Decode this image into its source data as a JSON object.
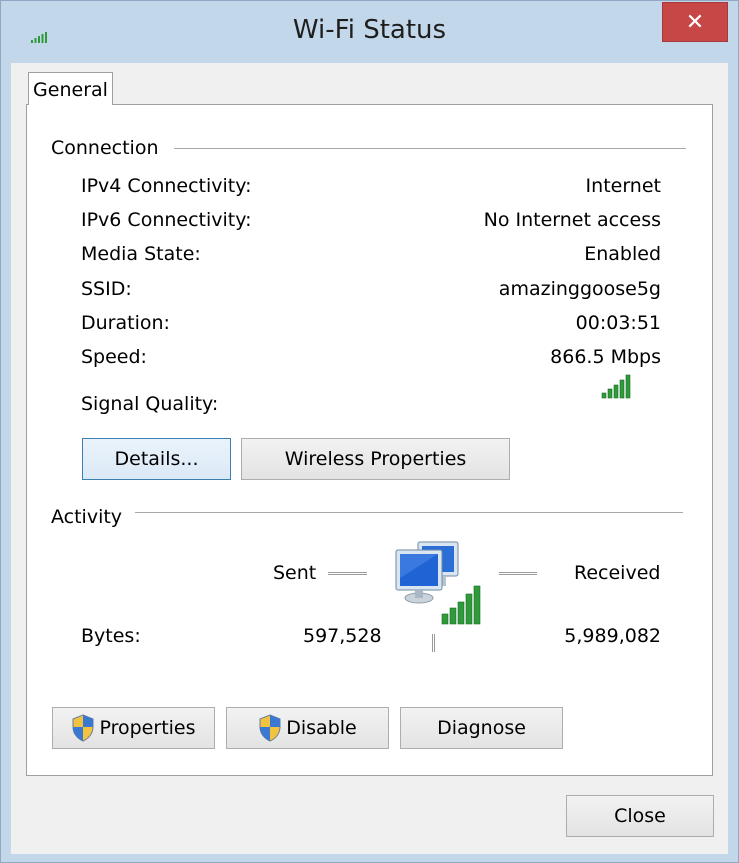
{
  "window": {
    "title": "Wi-Fi Status",
    "close_glyph": "✕"
  },
  "tabs": [
    {
      "label": "General",
      "selected": true
    }
  ],
  "connection": {
    "section_label": "Connection",
    "rows": [
      {
        "label": "IPv4 Connectivity:",
        "value": "Internet"
      },
      {
        "label": "IPv6 Connectivity:",
        "value": "No Internet access"
      },
      {
        "label": "Media State:",
        "value": "Enabled"
      },
      {
        "label": "SSID:",
        "value": "amazinggoose5g"
      },
      {
        "label": "Duration:",
        "value": "00:03:51"
      },
      {
        "label": "Speed:",
        "value": "866.5 Mbps"
      }
    ],
    "signal_quality_label": "Signal Quality:",
    "signal_bars": 5,
    "details_button": "Details...",
    "wireless_properties_button": "Wireless Properties"
  },
  "activity": {
    "section_label": "Activity",
    "sent_label": "Sent",
    "received_label": "Received",
    "bytes_label": "Bytes:",
    "bytes_sent": "597,528",
    "bytes_received": "5,989,082"
  },
  "bottom_buttons": {
    "properties": "Properties",
    "disable": "Disable",
    "diagnose": "Diagnose"
  },
  "close_button": "Close",
  "icons": {
    "title": "wifi-signal-icon",
    "shield": "uac-shield-icon",
    "network": "network-computers-icon"
  },
  "colors": {
    "signal_green": "#2e9a3a",
    "close_red": "#c74646",
    "frame": "#c2d7ea"
  }
}
